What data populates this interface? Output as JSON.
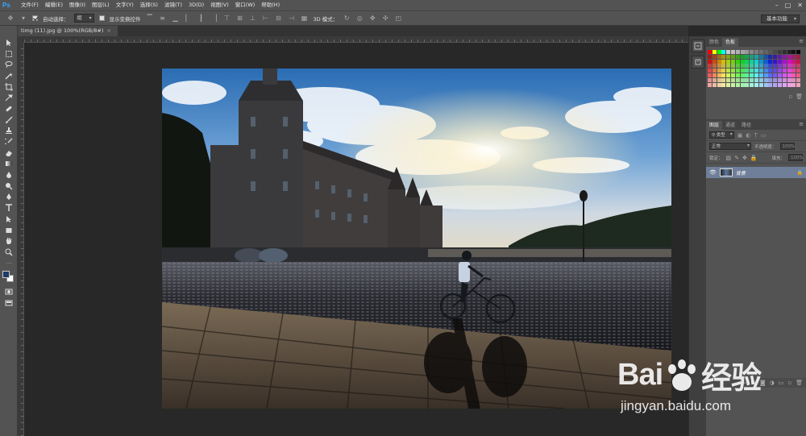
{
  "app": {
    "logo": "Ps"
  },
  "menubar": {
    "items": [
      "文件(F)",
      "编辑(E)",
      "图像(I)",
      "图层(L)",
      "文字(Y)",
      "选择(S)",
      "滤镜(T)",
      "3D(D)",
      "视图(V)",
      "窗口(W)",
      "帮助(H)"
    ]
  },
  "options": {
    "auto_select_label": "自动选择：",
    "auto_select_value": "组",
    "show_transform_label": "显示变换控件",
    "mode_3d_label": "3D 模式：",
    "workspace": "基本功能"
  },
  "document": {
    "tab_title": "timg (11).jpg @ 100%(RGB/8#)"
  },
  "swatches_panel": {
    "tabs": [
      "颜色",
      "色板"
    ]
  },
  "layers_panel": {
    "tabs": [
      "图层",
      "通道",
      "路径"
    ],
    "filter_kind": "类型",
    "blend_mode": "正常",
    "opacity_label": "不透明度：",
    "opacity_value": "100%",
    "lock_label": "锁定：",
    "fill_label": "填充：",
    "fill_value": "100%",
    "layers": [
      {
        "name": "背景"
      }
    ]
  },
  "colors": {
    "fg": "#1f3b66",
    "bg": "#ffffff",
    "accent": "#31a8ff"
  },
  "watermark": {
    "brand_text": "Bai",
    "brand_text_2": "经验",
    "sub": "jingyan.baidu.com"
  }
}
